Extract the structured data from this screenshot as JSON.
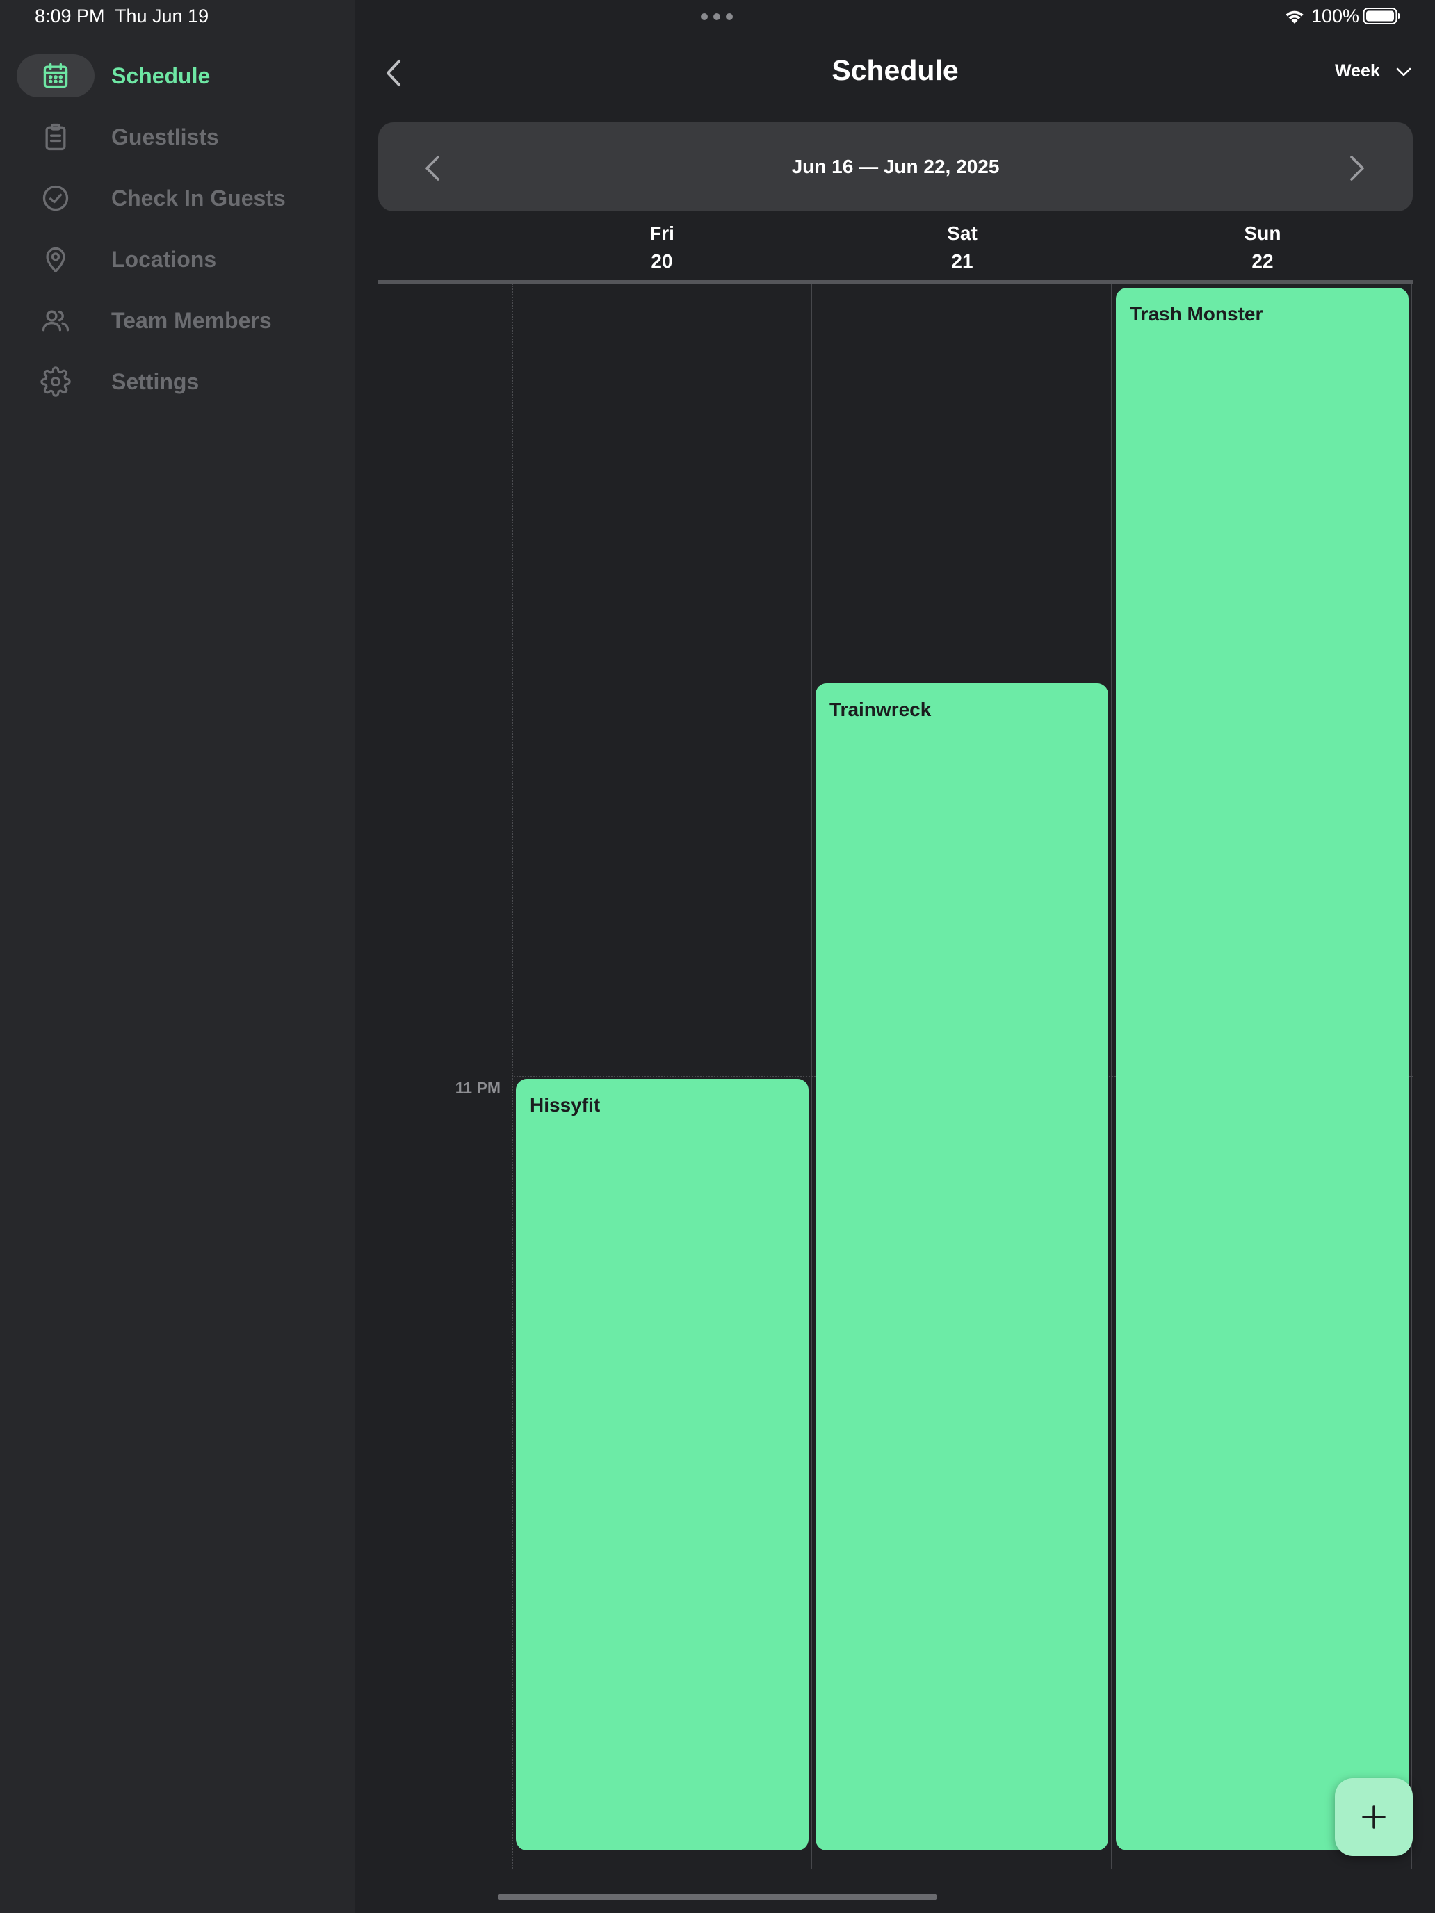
{
  "status_bar": {
    "time": "8:09 PM",
    "date": "Thu Jun 19",
    "battery": "100%"
  },
  "sidebar": {
    "items": [
      {
        "label": "Schedule",
        "icon": "calendar-icon",
        "active": true
      },
      {
        "label": "Guestlists",
        "icon": "clipboard-icon",
        "active": false
      },
      {
        "label": "Check In Guests",
        "icon": "check-circle-icon",
        "active": false
      },
      {
        "label": "Locations",
        "icon": "map-pin-icon",
        "active": false
      },
      {
        "label": "Team Members",
        "icon": "users-icon",
        "active": false
      },
      {
        "label": "Settings",
        "icon": "gear-icon",
        "active": false
      }
    ]
  },
  "header": {
    "title": "Schedule",
    "view_mode": "Week"
  },
  "week": {
    "range": "Jun 16 — Jun 22, 2025"
  },
  "days": [
    {
      "name": "Fri",
      "number": "20"
    },
    {
      "name": "Sat",
      "number": "21"
    },
    {
      "name": "Sun",
      "number": "22"
    }
  ],
  "time_labels": {
    "eleven_pm": "11 PM"
  },
  "events": [
    {
      "title": "Hissyfit",
      "day": "Fri"
    },
    {
      "title": "Trainwreck",
      "day": "Sat"
    },
    {
      "title": "Trash Monster",
      "day": "Sun"
    }
  ],
  "colors": {
    "accent": "#6ee7a4",
    "event_fill": "#6ceba6",
    "background": "#202124",
    "sidebar_bg": "#27282b",
    "fab_bg": "#a8f0c8"
  }
}
